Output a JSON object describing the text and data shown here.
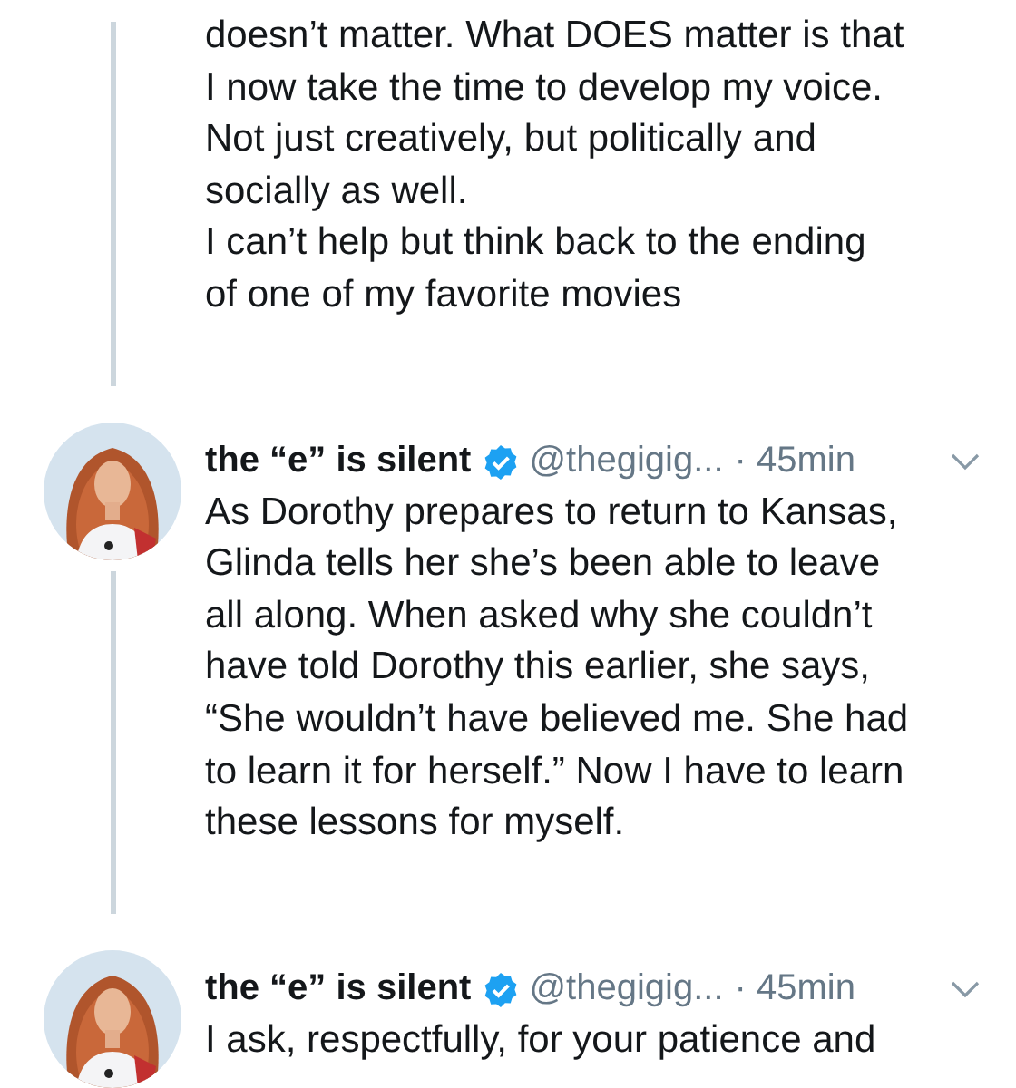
{
  "tweets": [
    {
      "text": "doesn’t matter. What DOES matter is that\nI now take the time to develop my voice.\nNot just creatively, but politically and\nsocially as well.\nI can’t help but think back to the ending\nof one of my favorite movies"
    },
    {
      "author": "the “e” is silent",
      "verified": true,
      "handle": "@thegigig...",
      "time": "· 45min",
      "text": "As Dorothy prepares to return to Kansas,\nGlinda tells her she’s been able to leave\nall along. When asked why she couldn’t\nhave told Dorothy this earlier, she says,\n“She wouldn’t have believed me. She had\nto learn it for herself.” Now I have to learn\nthese lessons for myself."
    },
    {
      "author": "the “e” is silent",
      "verified": true,
      "handle": "@thegigig...",
      "time": "· 45min",
      "text": "I ask, respectfully, for your patience and"
    }
  ]
}
